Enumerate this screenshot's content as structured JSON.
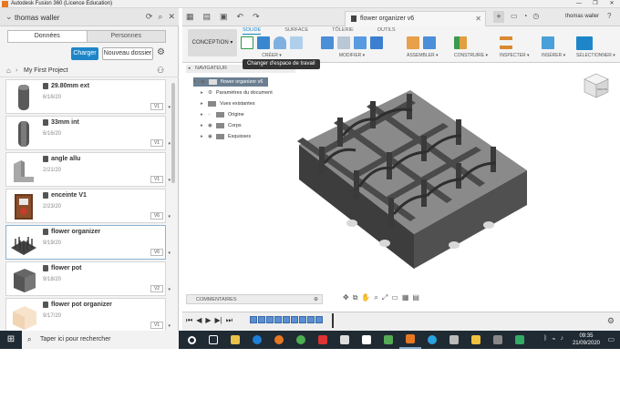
{
  "window": {
    "title": "Autodesk Fusion 360 (Licence Education)",
    "controls": [
      "—",
      "❐",
      "✕"
    ]
  },
  "data_panel": {
    "user": "thomas waller",
    "tabs": {
      "data": "Données",
      "people": "Personnes"
    },
    "upload_label": "Charger",
    "new_folder_label": "Nouveau dossier",
    "project": "My First Project",
    "files": [
      {
        "name": "29.80mm ext",
        "date": "6/16/20",
        "version": "V1"
      },
      {
        "name": "33mm int",
        "date": "6/16/20",
        "version": "V1"
      },
      {
        "name": "angle allu",
        "date": "2/21/20",
        "version": "V1"
      },
      {
        "name": "enceinte V1",
        "date": "2/23/20",
        "version": "V6"
      },
      {
        "name": "flower organizer",
        "date": "9/19/20",
        "version": "V6"
      },
      {
        "name": "flower pot",
        "date": "9/18/20",
        "version": "V2"
      },
      {
        "name": "flower pot organizer",
        "date": "9/17/20",
        "version": "V1"
      }
    ]
  },
  "document": {
    "title": "flower organizer v6",
    "user": "thomas waller"
  },
  "toolbar": {
    "workspace": "CONCEPTION ▾",
    "tabs": [
      "SOLIDE",
      "SURFACE",
      "TÔLERIE",
      "OUTILS"
    ],
    "active_tab": "SOLIDE",
    "groups": {
      "create": "CRÉER ▾",
      "modify": "MODIFIER ▾",
      "assemble": "ASSEMBLER ▾",
      "construct": "CONSTRUIRE ▾",
      "inspect": "INSPECTER ▾",
      "insert": "INSÉRER ▾",
      "select": "SÉLECTIONNER ▾"
    },
    "tooltip": "Changer d'espace de travail"
  },
  "browser": {
    "header": "NAVIGATEUR",
    "root": "flower organizer v6",
    "nodes": [
      "Paramètres du document",
      "Vues existantes",
      "Origine",
      "Corps",
      "Esquisses"
    ]
  },
  "comments_label": "COMMENTAIRES",
  "viewcube_label": "DROITE",
  "taskbar": {
    "search_placeholder": "Taper ici pour rechercher",
    "time": "09:35",
    "date": "21/09/2020"
  },
  "colors": {
    "accent": "#1e86c8",
    "taskbar": "#1f2a33",
    "model": "#6a6a6a"
  }
}
